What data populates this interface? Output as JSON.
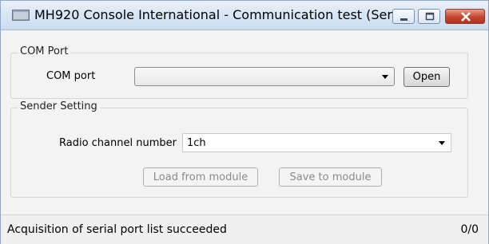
{
  "window": {
    "title": "MH920 Console International - Communication test (Sen...",
    "icon": "app-window-icon",
    "controls": [
      "minimize-icon",
      "maximize-icon",
      "close-icon"
    ]
  },
  "com_port_group": {
    "label": "COM Port",
    "field_label": "COM port",
    "selected_value": "",
    "open_button": "Open"
  },
  "sender_group": {
    "label": "Sender Setting",
    "field_label": "Radio channel number",
    "selected_value": "1ch",
    "load_button": "Load from module",
    "save_button": "Save to module"
  },
  "status": {
    "message": "Acquisition of serial port list succeeded",
    "count": "0/0"
  },
  "colors": {
    "close_button": "#c5452e",
    "titlebar": "#d9e6f5",
    "disabled_text": "#8a8a8a"
  }
}
